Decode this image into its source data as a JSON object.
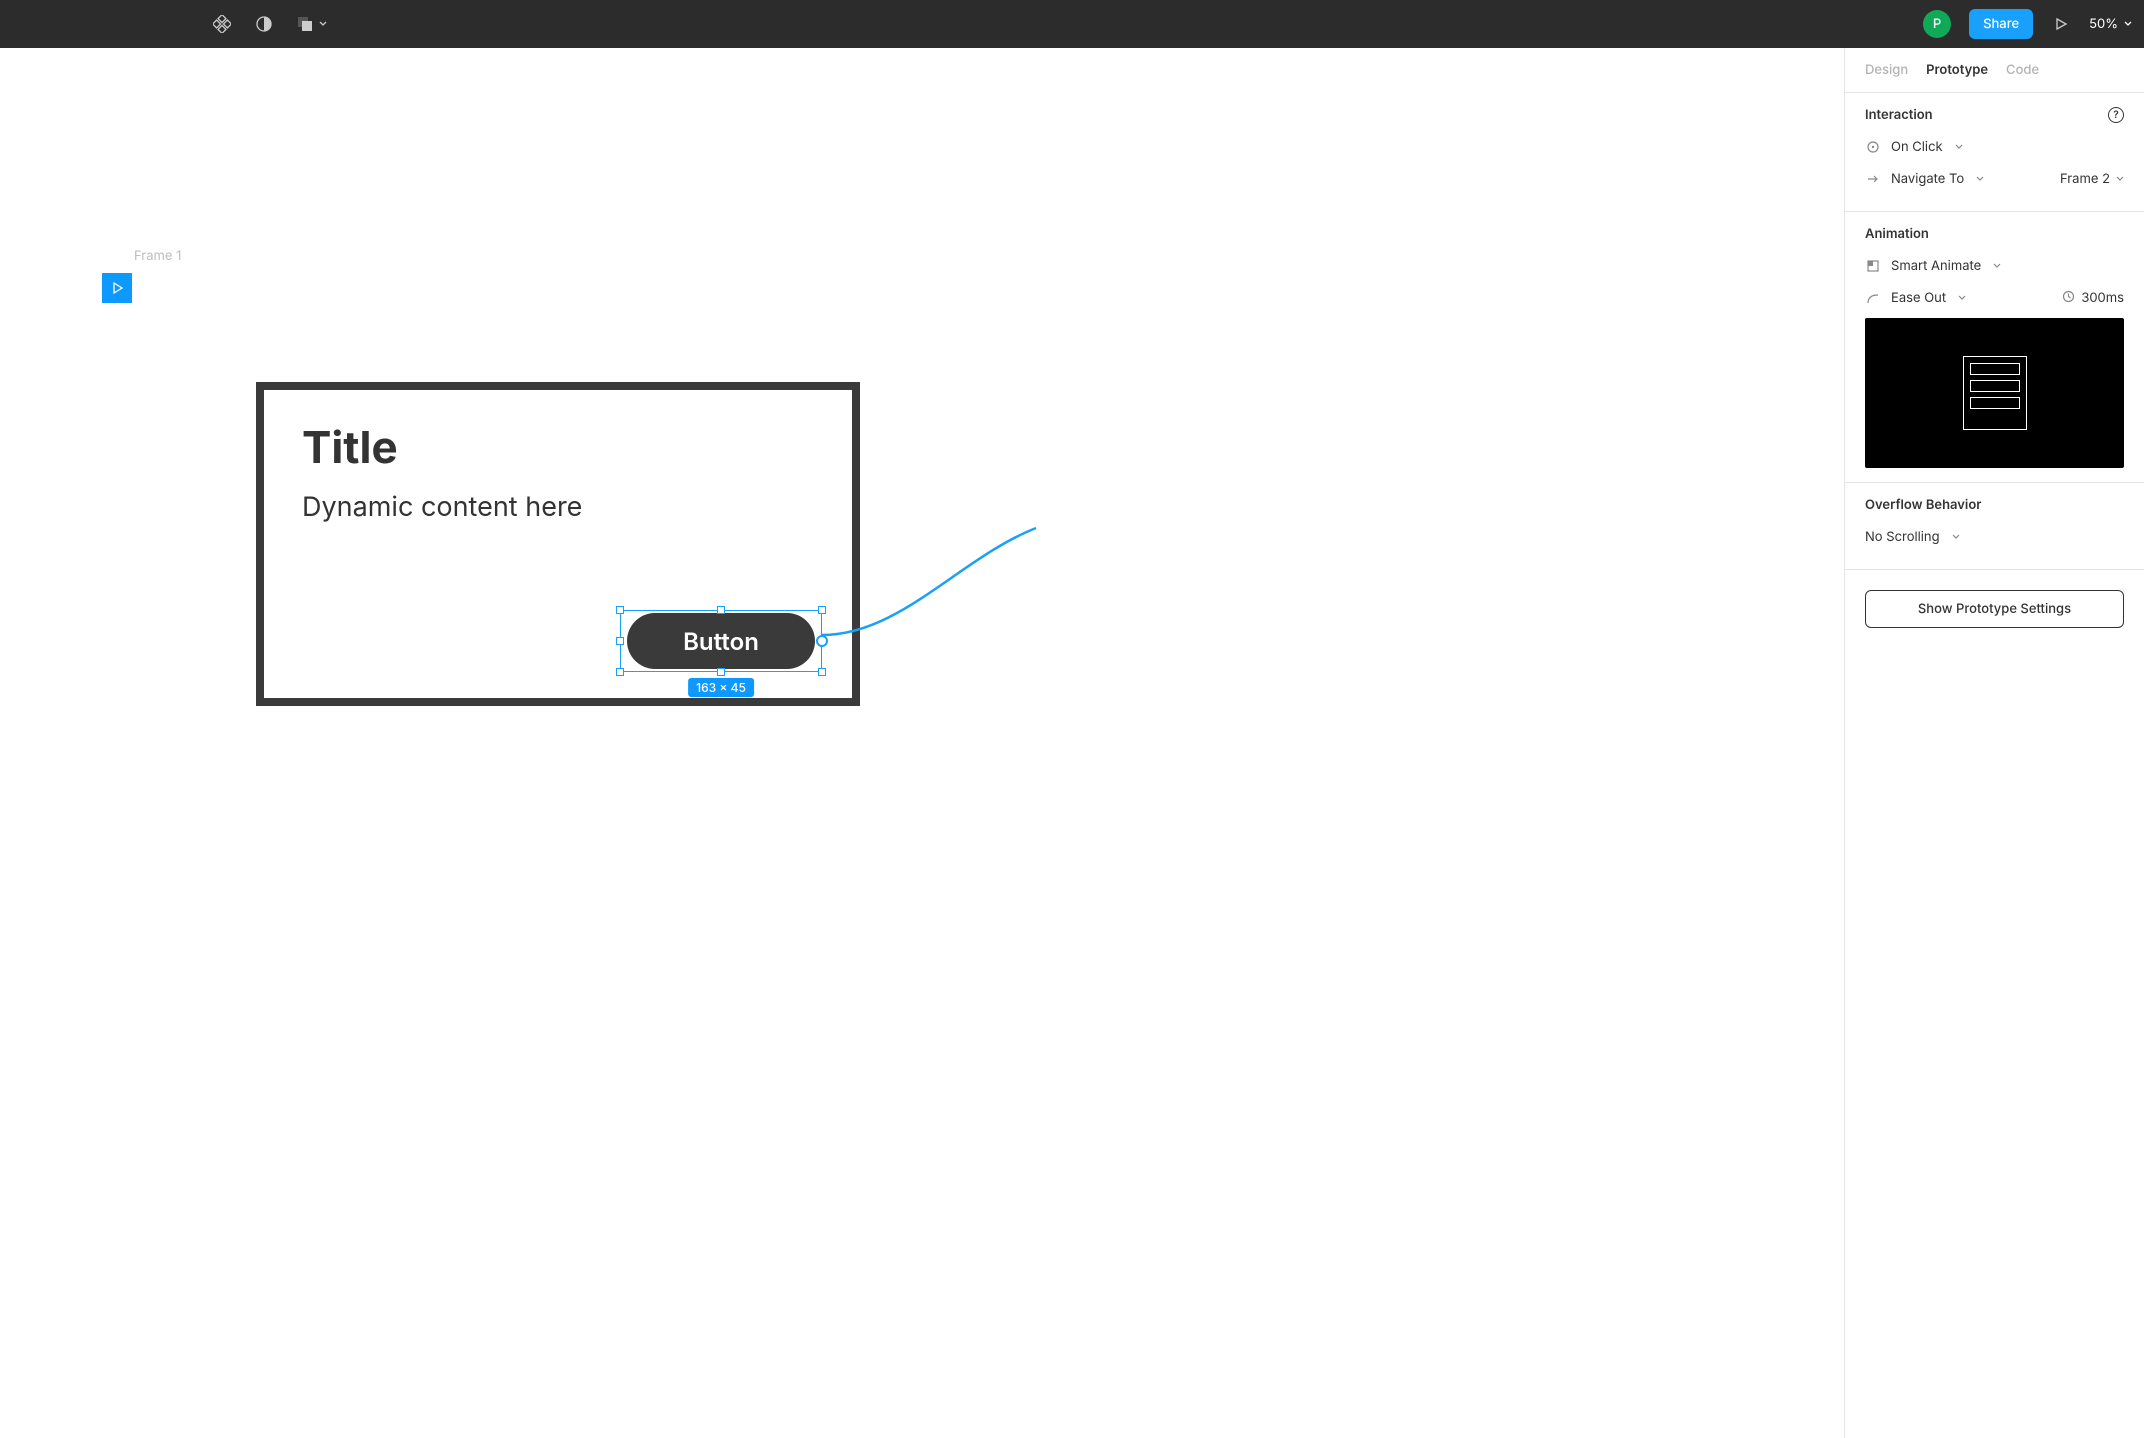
{
  "toolbar": {
    "avatar_initial": "P",
    "share_label": "Share",
    "zoom_label": "50%"
  },
  "tabs": {
    "design": "Design",
    "prototype": "Prototype",
    "code": "Code"
  },
  "interaction": {
    "heading": "Interaction",
    "trigger": "On Click",
    "action": "Navigate To",
    "destination": "Frame 2"
  },
  "animation": {
    "heading": "Animation",
    "type": "Smart Animate",
    "easing": "Ease Out",
    "duration": "300ms"
  },
  "overflow": {
    "heading": "Overflow Behavior",
    "value": "No Scrolling"
  },
  "proto_settings_label": "Show Prototype Settings",
  "canvas": {
    "frame_label": "Frame 1",
    "title": "Title",
    "description": "Dynamic content here",
    "button_label": "Button",
    "selection_size": "163 × 45"
  }
}
